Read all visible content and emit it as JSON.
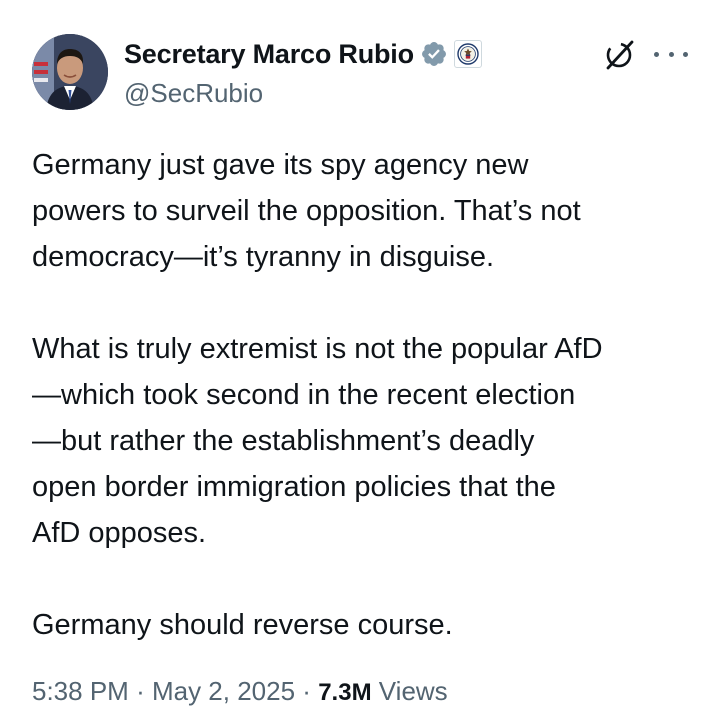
{
  "author": {
    "display_name": "Secretary Marco Rubio",
    "handle": "@SecRubio",
    "avatar_icon": "profile-photo",
    "verified_icon": "verified-badge-icon",
    "verified_color": "#829aab",
    "affiliation_icon": "state-department-seal-icon"
  },
  "actions": {
    "grok_icon": "grok-icon",
    "more_icon": "more-options-icon"
  },
  "tweet": {
    "paragraphs": [
      "Germany just gave its spy agency new\npowers to surveil the opposition.  That’s not\ndemocracy—it’s tyranny in disguise.",
      "What is truly extremist is not the popular AfD\n—which took second in the recent election\n—but rather the establishment’s deadly\nopen border immigration policies that the\nAfD opposes.",
      "Germany should reverse course."
    ]
  },
  "meta": {
    "time": "5:38 PM",
    "separator": "·",
    "date": "May 2, 2025",
    "views_count": "7.3M",
    "views_label": "Views"
  },
  "colors": {
    "text_primary": "#0f1419",
    "text_secondary": "#536471"
  }
}
